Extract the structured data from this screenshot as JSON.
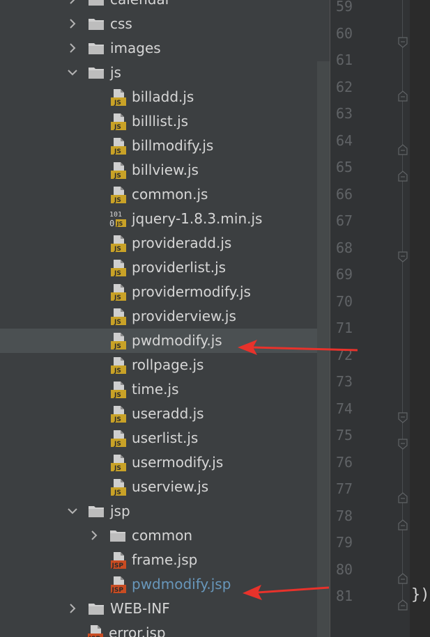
{
  "colors": {
    "panel": "#3c3f41",
    "selected_row": "#4b5052",
    "vcs_modified": "#6897bb",
    "arrow": "#e8322b",
    "js_icon": "#c9a227",
    "jsp_icon": "#c94c22"
  },
  "tree": {
    "rows": [
      {
        "kind": "folder",
        "label": "calendar",
        "expanded": false
      },
      {
        "kind": "folder",
        "label": "css",
        "expanded": false
      },
      {
        "kind": "folder",
        "label": "images",
        "expanded": false
      },
      {
        "kind": "folder",
        "label": "js",
        "expanded": true
      },
      {
        "kind": "file",
        "icon": "js-file-icon",
        "label": "billadd.js"
      },
      {
        "kind": "file",
        "icon": "js-file-icon",
        "label": "billlist.js"
      },
      {
        "kind": "file",
        "icon": "js-file-icon",
        "label": "billmodify.js"
      },
      {
        "kind": "file",
        "icon": "js-file-icon",
        "label": "billview.js"
      },
      {
        "kind": "file",
        "icon": "js-file-icon",
        "label": "common.js"
      },
      {
        "kind": "file",
        "icon": "minified-js-icon",
        "label": "jquery-1.8.3.min.js"
      },
      {
        "kind": "file",
        "icon": "js-file-icon",
        "label": "provideradd.js"
      },
      {
        "kind": "file",
        "icon": "js-file-icon",
        "label": "providerlist.js"
      },
      {
        "kind": "file",
        "icon": "js-file-icon",
        "label": "providermodify.js"
      },
      {
        "kind": "file",
        "icon": "js-file-icon",
        "label": "providerview.js"
      },
      {
        "kind": "file",
        "icon": "js-file-icon",
        "label": "pwdmodify.js",
        "selected": true
      },
      {
        "kind": "file",
        "icon": "js-file-icon",
        "label": "rollpage.js"
      },
      {
        "kind": "file",
        "icon": "js-file-icon",
        "label": "time.js"
      },
      {
        "kind": "file",
        "icon": "js-file-icon",
        "label": "useradd.js"
      },
      {
        "kind": "file",
        "icon": "js-file-icon",
        "label": "userlist.js"
      },
      {
        "kind": "file",
        "icon": "js-file-icon",
        "label": "usermodify.js"
      },
      {
        "kind": "file",
        "icon": "js-file-icon",
        "label": "userview.js"
      },
      {
        "kind": "folder",
        "label": "jsp",
        "expanded": true
      },
      {
        "kind": "folder",
        "label": "common",
        "expanded": false
      },
      {
        "kind": "file",
        "icon": "jsp-file-icon",
        "label": "frame.jsp"
      },
      {
        "kind": "file",
        "icon": "jsp-file-icon",
        "label": "pwdmodify.jsp",
        "modified": true
      },
      {
        "kind": "folder",
        "label": "WEB-INF",
        "expanded": false
      },
      {
        "kind": "file",
        "icon": "jsp-file-icon",
        "label": "error.jsp"
      }
    ]
  },
  "gutter": {
    "line_numbers": [
      "59",
      "60",
      "61",
      "62",
      "63",
      "64",
      "65",
      "66",
      "67",
      "68",
      "69",
      "70",
      "71",
      "72",
      "73",
      "74",
      "75",
      "76",
      "77",
      "78",
      "79",
      "80",
      "81"
    ]
  },
  "code": {
    "closing_text": "})"
  }
}
